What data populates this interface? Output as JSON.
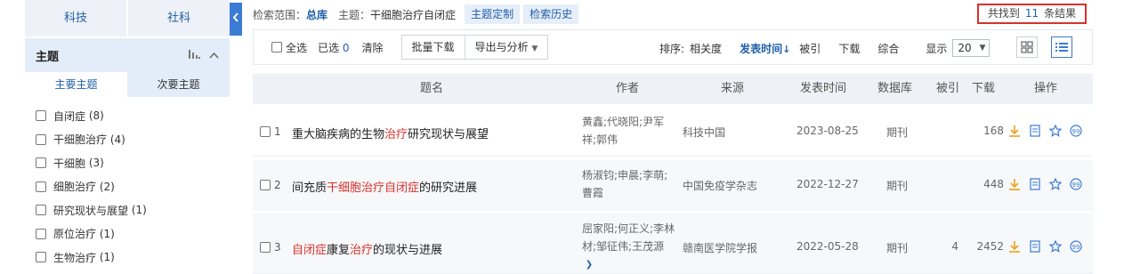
{
  "sidebar": {
    "category_tabs": [
      "科技",
      "社科"
    ],
    "facet": {
      "title": "主题",
      "sub_tabs": [
        "主要主题",
        "次要主题"
      ],
      "items": [
        {
          "label": "自闭症",
          "count": "(8)"
        },
        {
          "label": "干细胞治疗",
          "count": "(4)"
        },
        {
          "label": "干细胞",
          "count": "(3)"
        },
        {
          "label": "细胞治疗",
          "count": "(2)"
        },
        {
          "label": "研究现状与展望",
          "count": "(1)"
        },
        {
          "label": "原位治疗",
          "count": "(1)"
        },
        {
          "label": "生物治疗",
          "count": "(1)"
        }
      ]
    }
  },
  "info_bar": {
    "scope_label": "检索范围：",
    "scope_value": "总库",
    "topic_label": "主题：",
    "topic_value": "干细胞治疗自闭症",
    "btn_customize": "主题定制",
    "btn_history": "检索历史",
    "found_prefix": "共找到",
    "found_count": "11",
    "found_suffix": "条结果"
  },
  "toolbar": {
    "select_all": "全选",
    "selected_label": "已选",
    "selected_count": "0",
    "clear": "清除",
    "batch_download": "批量下载",
    "export_analysis": "导出与分析",
    "sort_label": "排序:",
    "sort_options": [
      "相关度",
      "发表时间",
      "被引",
      "下载",
      "综合"
    ],
    "active_sort": "发表时间",
    "display_label": "显示",
    "page_size": "20"
  },
  "table": {
    "headers": [
      "题名",
      "作者",
      "来源",
      "发表时间",
      "数据库",
      "被引",
      "下载",
      "操作"
    ],
    "rows": [
      {
        "index": "1",
        "title_parts": [
          {
            "text": "重大脑疾病的生物",
            "hl": false
          },
          {
            "text": "治疗",
            "hl": true
          },
          {
            "text": "研究现状与展望",
            "hl": false
          }
        ],
        "authors_line1": "黄鑫;代晓阳;尹军",
        "authors_line2": "祥;郭伟",
        "source": "科技中国",
        "date": "2023-08-25",
        "database": "期刊",
        "cited": "",
        "downloads": "168"
      },
      {
        "index": "2",
        "title_parts": [
          {
            "text": "间充质",
            "hl": false
          },
          {
            "text": "干细胞治疗自闭症",
            "hl": true
          },
          {
            "text": "的研究进展",
            "hl": false
          }
        ],
        "authors_line1": "杨淑钧;申晨;李萌;",
        "authors_line2": "曹霞",
        "source": "中国免疫学杂志",
        "date": "2022-12-27",
        "database": "期刊",
        "cited": "",
        "downloads": "448"
      },
      {
        "index": "3",
        "title_parts": [
          {
            "text": "自闭症",
            "hl": true
          },
          {
            "text": "康复",
            "hl": false
          },
          {
            "text": "治疗",
            "hl": true
          },
          {
            "text": "的现状与进展",
            "hl": false
          }
        ],
        "authors_line1": "屈家阳;何正义;李林",
        "authors_line2": "材;邹征伟;王茂源",
        "source": "赣南医学院学报",
        "date": "2022-05-28",
        "database": "期刊",
        "cited": "4",
        "downloads": "2452"
      }
    ]
  },
  "colors": {
    "accent": "#1f5fa8",
    "highlight": "#d9312b",
    "download_icon": "#e8a21b",
    "panel_bg": "#e3edf9"
  }
}
